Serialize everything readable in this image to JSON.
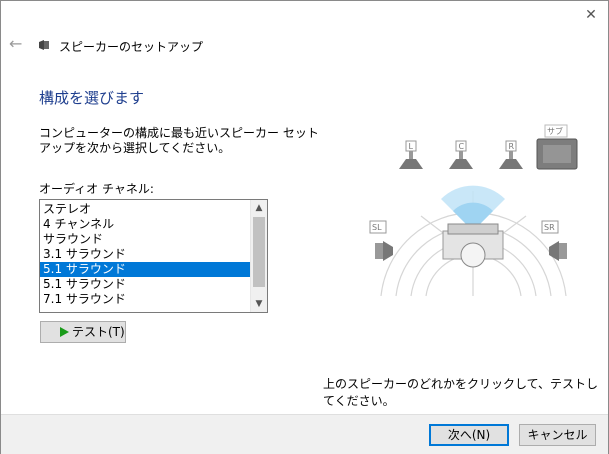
{
  "window": {
    "title": "スピーカーのセットアップ"
  },
  "page": {
    "heading": "構成を選びます",
    "description": "コンピューターの構成に最も近いスピーカー セットアップを次から選択してください。",
    "channel_label": "オーディオ チャネル:"
  },
  "channels": {
    "items": [
      {
        "label": "ステレオ"
      },
      {
        "label": "4 チャンネル"
      },
      {
        "label": "サラウンド"
      },
      {
        "label": "3.1 サラウンド"
      },
      {
        "label": "5.1 サラウンド"
      },
      {
        "label": "5.1 サラウンド"
      },
      {
        "label": "7.1 サラウンド"
      }
    ],
    "selected_index": 4
  },
  "test_button": {
    "label": "テスト(T)"
  },
  "hint": "上のスピーカーのどれかをクリックして、テストしてください。",
  "speakers": {
    "left": "L",
    "center": "C",
    "right": "R",
    "subwoofer": "サブ",
    "surround_left": "SL",
    "surround_right": "SR"
  },
  "footer": {
    "next_label": "次へ(N)",
    "cancel_label": "キャンセル"
  },
  "colors": {
    "heading": "#1e3e8e",
    "selection": "#0078d7",
    "play": "#1a9b1a"
  }
}
